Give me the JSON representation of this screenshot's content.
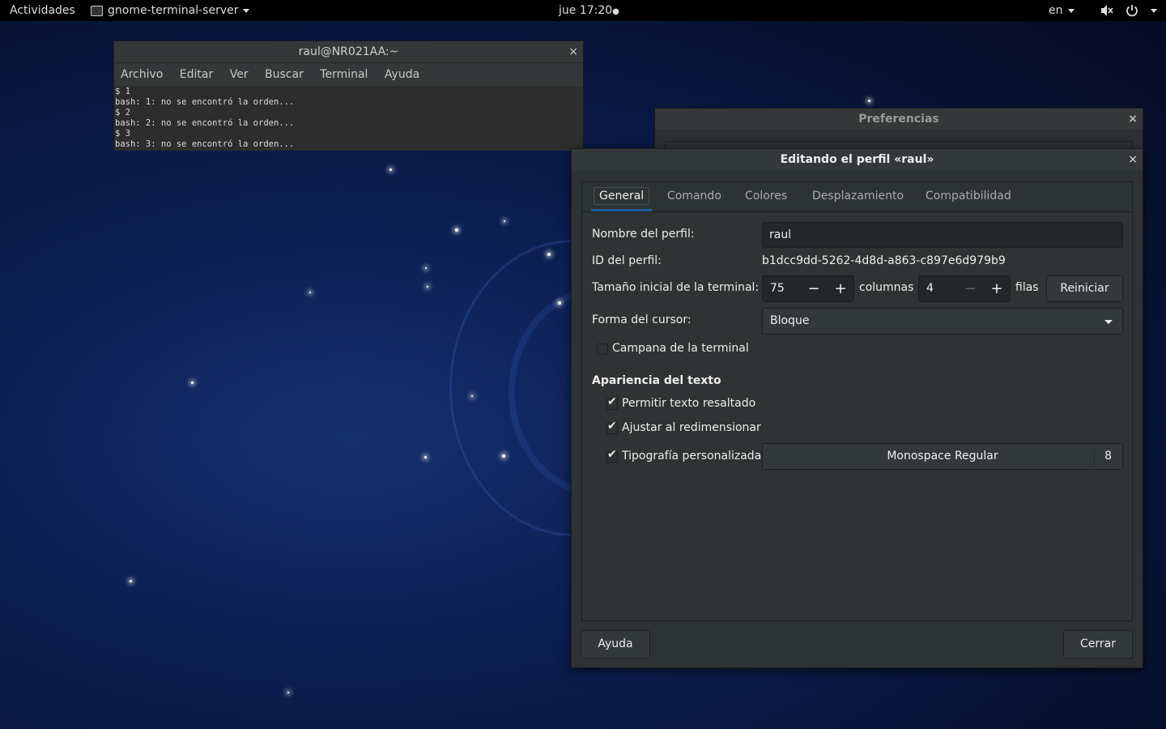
{
  "topbar": {
    "activities": "Actividades",
    "app_menu": "gnome-terminal-server",
    "clock": "jue 17:20",
    "clock_dot": "●",
    "lang": "en"
  },
  "terminal": {
    "title": "raul@NR021AA:~",
    "close": "×",
    "menu": [
      "Archivo",
      "Editar",
      "Ver",
      "Buscar",
      "Terminal",
      "Ayuda"
    ],
    "lines": [
      "$ 1",
      "bash: 1: no se encontró la orden...",
      "$ 2",
      "bash: 2: no se encontró la orden...",
      "$ 3",
      "bash: 3: no se encontró la orden..."
    ]
  },
  "preferences": {
    "title": "Preferencias",
    "close": "×"
  },
  "dialog": {
    "title": "Editando el perfil «raul»",
    "close": "×",
    "tabs": [
      "General",
      "Comando",
      "Colores",
      "Desplazamiento",
      "Compatibilidad"
    ],
    "profile_name_label": "Nombre del perfil:",
    "profile_name_value": "raul",
    "profile_id_label": "ID del perfil:",
    "profile_id_value": "b1dcc9dd-5262-4d8d-a863-c897e6d979b9",
    "size_label": "Tamaño inicial de la terminal:",
    "columns_value": "75",
    "columns_unit": "columnas",
    "rows_value": "4",
    "rows_unit": "filas",
    "minus": "−",
    "plus": "+",
    "reset_button": "Reiniciar",
    "cursor_label": "Forma del cursor:",
    "cursor_value": "Bloque",
    "bell_label": "Campana de la terminal",
    "bell_checked": false,
    "appearance_title": "Apariencia del texto",
    "bold_label": "Permitir texto resaltado",
    "bold_checked": true,
    "rewrap_label": "Ajustar al redimensionar",
    "rewrap_checked": true,
    "custom_font_label": "Tipografía personalizada:",
    "custom_font_checked": true,
    "font_name": "Monospace Regular",
    "font_size": "8",
    "help_button": "Ayuda",
    "close_button": "Cerrar"
  },
  "colors": {
    "accent": "#215d9c",
    "window_bg": "#2d3233"
  }
}
